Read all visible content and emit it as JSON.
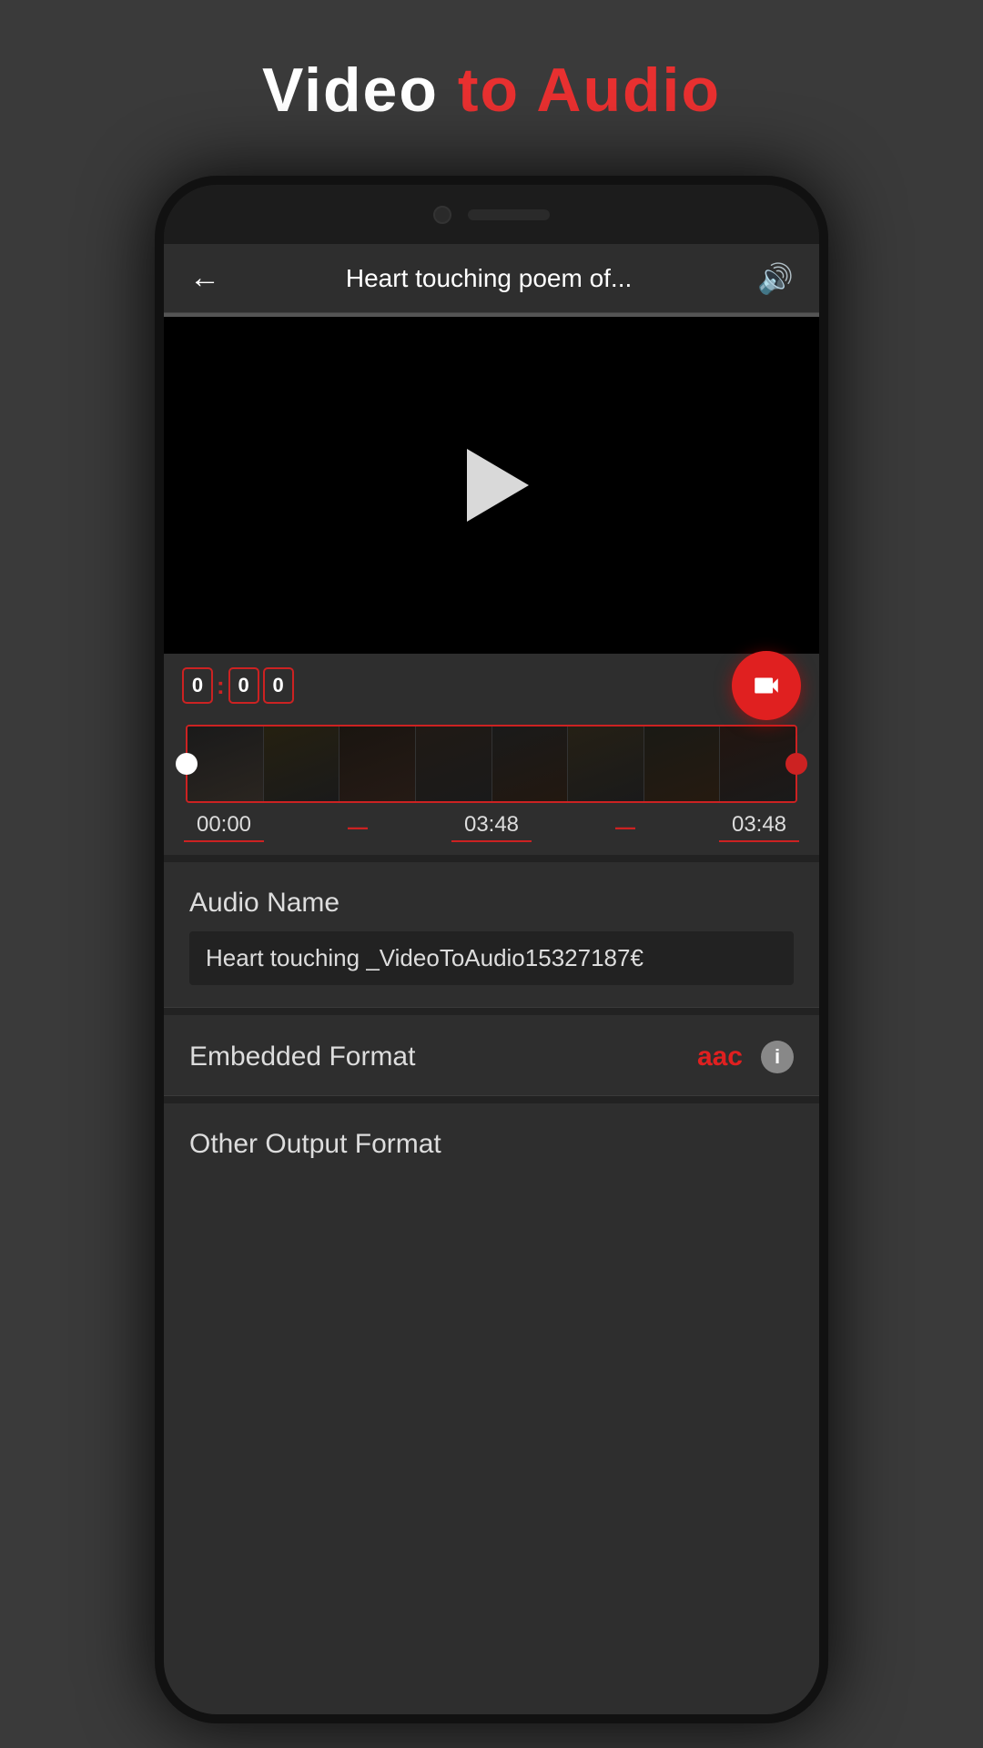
{
  "page": {
    "title_part1": "Video",
    "title_to": " to ",
    "title_part2": "Audio"
  },
  "topbar": {
    "title": "Heart touching poem of...",
    "back_label": "←",
    "volume_icon": "🔊"
  },
  "timer": {
    "digit1": "0",
    "colon1": ":",
    "digit2": "0",
    "digit3": "0"
  },
  "filmstrip": {
    "time_start": "00:00",
    "time_mid": "03:48",
    "time_end": "03:48",
    "dash1": "—",
    "dash2": "—"
  },
  "audio_name": {
    "label": "Audio Name",
    "value": "Heart touching _VideoToAudio15327187€"
  },
  "embedded_format": {
    "label": "Embedded Format",
    "value": "aac",
    "info_label": "i"
  },
  "other_output": {
    "label": "Other Output Format"
  },
  "record_icon": "📹"
}
